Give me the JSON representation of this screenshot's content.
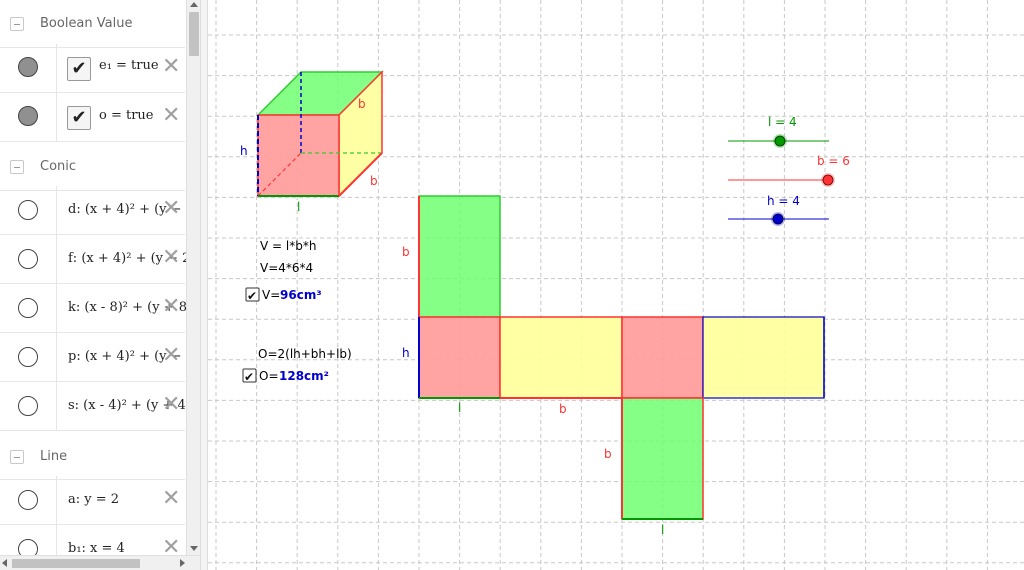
{
  "colors": {
    "green_face": "#66ff66",
    "red_face": "#ff9999",
    "yellow_face": "#ffff99",
    "edge_green": "#33cc33",
    "edge_red": "#ff3333",
    "edge_blue": "#0000cc",
    "grid": "#c8c8c8",
    "slider_l": "#009900",
    "slider_b": "#ff3333",
    "slider_h": "#0000cc",
    "formula_value": "#0000cc"
  },
  "algebra": {
    "groups": [
      {
        "title": "Boolean Value",
        "items": [
          {
            "marble": "filled",
            "checkbox": "checked",
            "label": "e₁ = true"
          },
          {
            "marble": "filled",
            "checkbox": "checked",
            "label": "o = true"
          }
        ]
      },
      {
        "title": "Conic",
        "items": [
          {
            "marble": "empty",
            "label": "d: (x + 4)² + (y − 2"
          },
          {
            "marble": "empty",
            "label": "f: (x + 4)² + (y − 2)"
          },
          {
            "marble": "empty",
            "label": "k: (x - 8)² + (y + 8"
          },
          {
            "marble": "empty",
            "label": "p: (x + 4)² + (y − 2"
          },
          {
            "marble": "empty",
            "label": "s: (x - 4)² + (y + 4"
          }
        ]
      },
      {
        "title": "Line",
        "items": [
          {
            "marble": "empty",
            "label": "a: y = 2"
          },
          {
            "marble": "empty",
            "label": "b₁: x = 4"
          }
        ]
      }
    ],
    "icons": {
      "collapse": "collapse-toggle-icon",
      "delete": "delete-x-icon",
      "checkmark": "checkmark-icon"
    }
  },
  "graphics": {
    "cube_labels": {
      "h": "h",
      "l": "l",
      "b_top": "b",
      "b_right": "b"
    },
    "net_labels": {
      "b_left": "b",
      "h": "h",
      "l": "l",
      "b_bottom": "b",
      "b_lower": "b",
      "l_lower": "l"
    },
    "sliders": {
      "l": {
        "label": "l = 4",
        "value": 4
      },
      "b": {
        "label": "b = 6",
        "value": 6
      },
      "h": {
        "label": "h = 4",
        "value": 4
      }
    },
    "volume": {
      "formula": "V = l*b*h",
      "substituted": "V=4*6*4",
      "result_label": "V=",
      "result_value": "96cm³",
      "checked": true
    },
    "surface": {
      "formula": "O=2(lh+bh+lb)",
      "result_label": "O=",
      "result_value": "128cm²",
      "checked": true
    }
  }
}
